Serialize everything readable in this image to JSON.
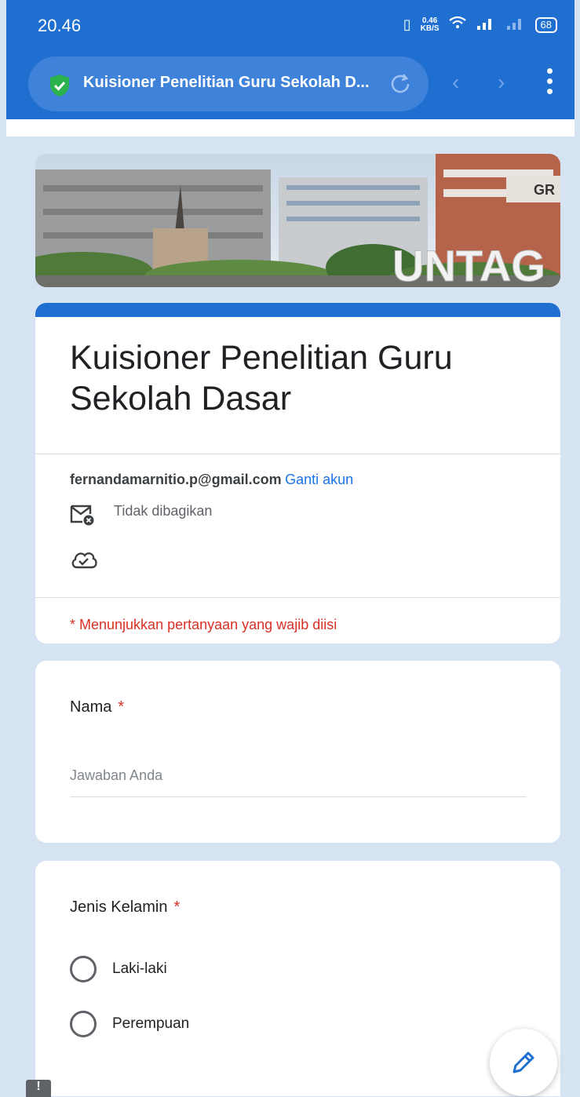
{
  "status_bar": {
    "time": "20.46",
    "speed_value": "0.46",
    "speed_unit": "KB/S",
    "battery": "68"
  },
  "browser": {
    "url_title": "Kuisioner Penelitian Guru Sekolah D...",
    "icons": [
      "shield-icon",
      "reload-icon",
      "back-icon",
      "forward-icon",
      "menu-icon"
    ]
  },
  "form": {
    "title": "Kuisioner Penelitian Guru Sekolah Dasar",
    "account_email": "fernandamarnitio.p@gmail.com",
    "switch_account": "Ganti akun",
    "not_shared": "Tidak dibagikan",
    "required_note": "* Menunjukkan pertanyaan yang wajib diisi",
    "questions": [
      {
        "label": "Nama",
        "required": "*",
        "placeholder": "Jawaban Anda"
      },
      {
        "label": "Jenis Kelamin",
        "required": "*",
        "options": [
          "Laki-laki",
          "Perempuan"
        ]
      }
    ]
  },
  "alert_chip": "!",
  "colors": {
    "accent": "#1f6fd1",
    "page_bg": "#d6e3f3",
    "required": "#d93025",
    "link": "#1a73e8"
  }
}
